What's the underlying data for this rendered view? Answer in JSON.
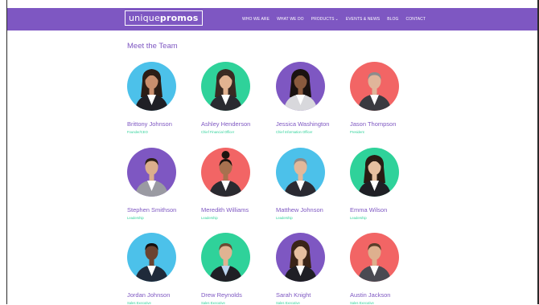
{
  "logo": {
    "part1": "unique",
    "part2": "promos"
  },
  "nav": [
    {
      "label": "WHO WE ARE"
    },
    {
      "label": "WHAT WE DO"
    },
    {
      "label": "PRODUCTS"
    },
    {
      "label": "EVENTS & NEWS"
    },
    {
      "label": "BLOG"
    },
    {
      "label": "CONTACT"
    }
  ],
  "nav_caret": "⌄",
  "section_title": "Meet the Team",
  "colors": {
    "purple": "#7e57c2",
    "blue": "#4cc1ea",
    "green": "#2fd29a",
    "red": "#f26565"
  },
  "team": [
    {
      "name": "Brittony Johnson",
      "role": "Founder/CEO",
      "bg": "#4cc1ea",
      "skin": "#c98f6e",
      "hair": "#2b1d16",
      "suit": "#1f1f25",
      "shirt": "#ffffff",
      "hair_style": "long",
      "icon": "person-female-icon"
    },
    {
      "name": "Ashley Henderson",
      "role": "Chief Financial Officer",
      "bg": "#2fd29a",
      "skin": "#e2b391",
      "hair": "#3a2a22",
      "suit": "#2a2a30",
      "shirt": "#ffffff",
      "hair_style": "long",
      "icon": "person-female-icon"
    },
    {
      "name": "Jessica Washington",
      "role": "Chief Information Officer",
      "bg": "#7e57c2",
      "skin": "#8a5a3e",
      "hair": "#1a1210",
      "suit": "#d8d8dc",
      "shirt": "#ffffff",
      "hair_style": "long",
      "icon": "person-female-icon"
    },
    {
      "name": "Jason Thompson",
      "role": "President",
      "bg": "#f26565",
      "skin": "#e0b59a",
      "hair": "#8c8c8c",
      "suit": "#3a3a40",
      "shirt": "#ffffff",
      "hair_style": "short",
      "icon": "person-male-icon"
    },
    {
      "name": "Stephen Smithson",
      "role": "Leadership",
      "bg": "#7e57c2",
      "skin": "#dcae8c",
      "hair": "#2e2018",
      "suit": "#9a9aa2",
      "shirt": "#ffffff",
      "hair_style": "short",
      "icon": "person-male-icon"
    },
    {
      "name": "Meredith Williams",
      "role": "Leadership",
      "bg": "#f26565",
      "skin": "#a8714f",
      "hair": "#1c1410",
      "suit": "#2a2a30",
      "shirt": "#ffffff",
      "hair_style": "bun",
      "icon": "person-female-icon"
    },
    {
      "name": "Matthew Johnson",
      "role": "Leadership",
      "bg": "#4cc1ea",
      "skin": "#e2b89a",
      "hair": "#8a8a8a",
      "suit": "#2a2a32",
      "shirt": "#ffffff",
      "hair_style": "short",
      "icon": "person-male-icon"
    },
    {
      "name": "Emma Wilson",
      "role": "Leadership",
      "bg": "#2fd29a",
      "skin": "#e6bfa0",
      "hair": "#2a1c14",
      "suit": "#1f1f25",
      "shirt": "#ffffff",
      "hair_style": "long",
      "icon": "person-female-icon"
    },
    {
      "name": "Jordan Johnson",
      "role": "Sales Executive",
      "bg": "#4cc1ea",
      "skin": "#6b4330",
      "hair": "#141010",
      "suit": "#1f2a3a",
      "shirt": "#ffffff",
      "hair_style": "short",
      "icon": "person-male-icon"
    },
    {
      "name": "Drew Reynolds",
      "role": "Sales Executive",
      "bg": "#2fd29a",
      "skin": "#e0b392",
      "hair": "#6a4a32",
      "suit": "#1f1f25",
      "shirt": "#bcd4ee",
      "hair_style": "short",
      "icon": "person-male-icon"
    },
    {
      "name": "Sarah Knight",
      "role": "Sales Executive",
      "bg": "#7e57c2",
      "skin": "#e6bfa0",
      "hair": "#3a2418",
      "suit": "#1f1f25",
      "shirt": "#ffffff",
      "hair_style": "long",
      "icon": "person-female-icon"
    },
    {
      "name": "Austin Jackson",
      "role": "Sales Executive",
      "bg": "#f26565",
      "skin": "#deb08e",
      "hair": "#5a3e2a",
      "suit": "#4a4a52",
      "shirt": "#ffffff",
      "hair_style": "short",
      "icon": "person-male-icon"
    }
  ]
}
